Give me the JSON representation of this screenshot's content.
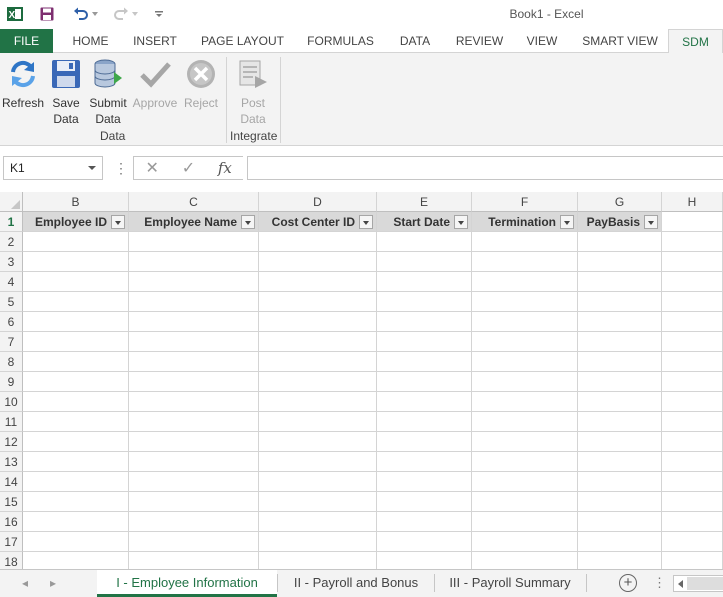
{
  "app": {
    "title": "Book1 - Excel",
    "accent_color": "#217346"
  },
  "quick_access": {
    "icons": [
      "excel-logo-icon",
      "save-icon",
      "undo-icon",
      "redo-icon",
      "customize-icon"
    ]
  },
  "ribbon_tabs": [
    {
      "label": "FILE"
    },
    {
      "label": "HOME"
    },
    {
      "label": "INSERT"
    },
    {
      "label": "PAGE LAYOUT"
    },
    {
      "label": "FORMULAS"
    },
    {
      "label": "DATA"
    },
    {
      "label": "REVIEW"
    },
    {
      "label": "VIEW"
    },
    {
      "label": "SMART VIEW"
    },
    {
      "label": "SDM"
    }
  ],
  "active_tab": "SDM",
  "ribbon": {
    "groups": [
      {
        "label": "Data",
        "buttons": [
          {
            "line1": "Refresh",
            "line2": "",
            "icon": "refresh-icon",
            "enabled": true
          },
          {
            "line1": "Save",
            "line2": "Data",
            "icon": "floppy-disk-icon",
            "enabled": true
          },
          {
            "line1": "Submit",
            "line2": "Data",
            "icon": "database-submit-icon",
            "enabled": true
          },
          {
            "line1": "Approve",
            "line2": "",
            "icon": "checkmark-icon",
            "enabled": false
          },
          {
            "line1": "Reject",
            "line2": "",
            "icon": "reject-x-icon",
            "enabled": false
          }
        ]
      },
      {
        "label": "Integrate",
        "buttons": [
          {
            "line1": "Post",
            "line2": "Data",
            "icon": "post-data-icon",
            "enabled": false
          }
        ]
      }
    ]
  },
  "formula_bar": {
    "name_box": "K1",
    "fx": "fx",
    "value": ""
  },
  "grid": {
    "columns": [
      "B",
      "C",
      "D",
      "E",
      "F",
      "G",
      "H"
    ],
    "rows": [
      "1",
      "2",
      "3",
      "4",
      "5",
      "6",
      "7",
      "8",
      "9",
      "10",
      "11",
      "12",
      "13",
      "14",
      "15",
      "16",
      "17",
      "18"
    ],
    "header_row": [
      "Employee ID",
      "Employee Name",
      "Cost Center ID",
      "Start Date",
      "Termination",
      "PayBasis"
    ],
    "selected_row": "1"
  },
  "sheets": [
    {
      "label": "I - Employee Information",
      "active": true
    },
    {
      "label": "II - Payroll and Bonus",
      "active": false
    },
    {
      "label": "III - Payroll Summary",
      "active": false
    }
  ]
}
